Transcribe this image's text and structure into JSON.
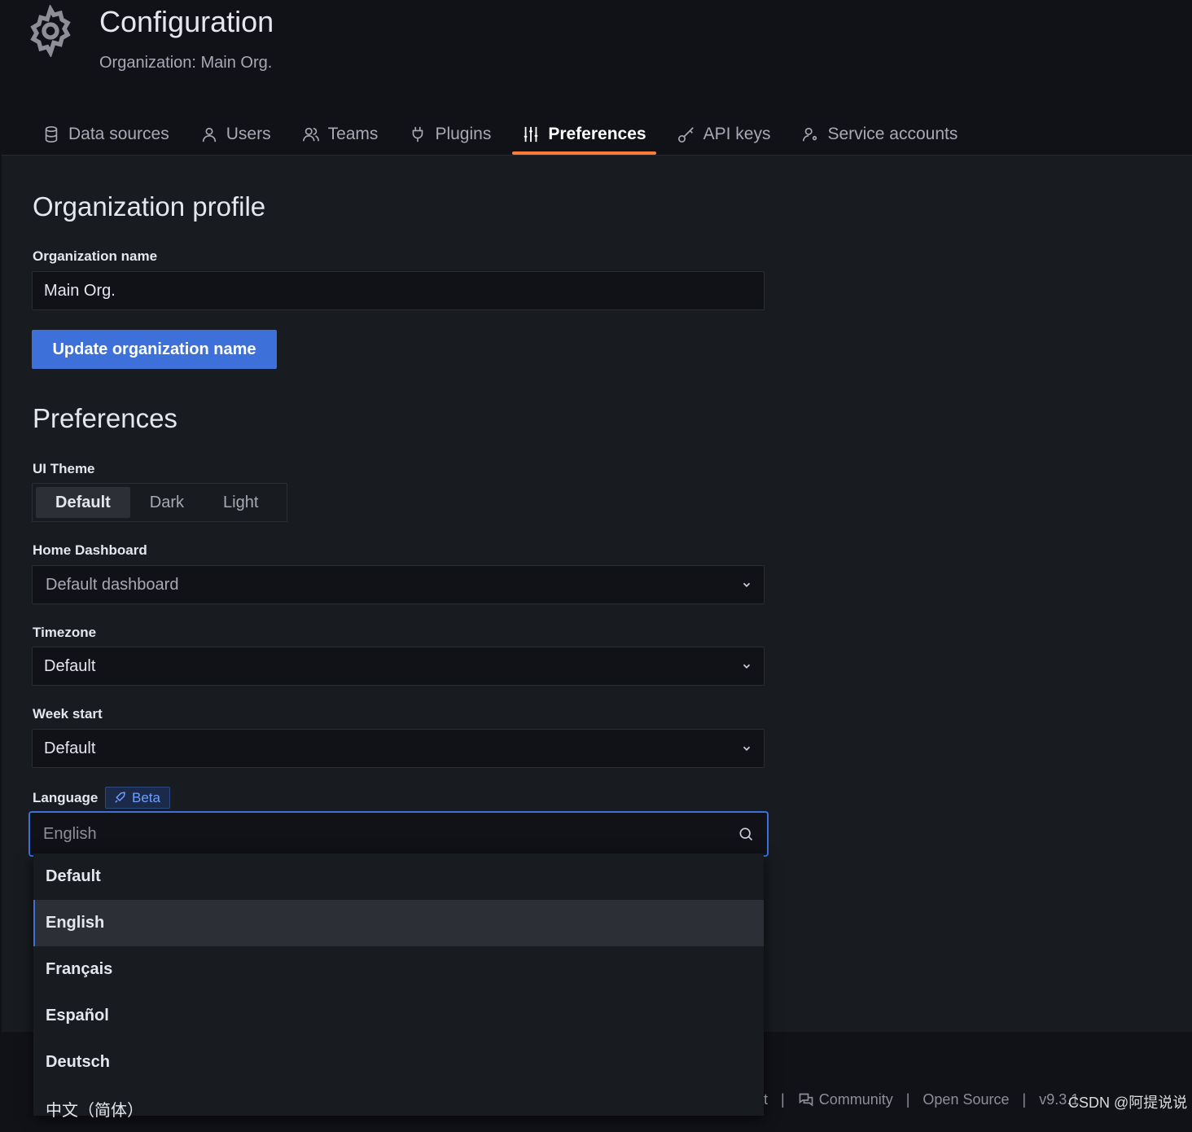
{
  "header": {
    "title": "Configuration",
    "subtitle": "Organization: Main Org.",
    "icon": "gear-icon"
  },
  "tabs": [
    {
      "label": "Data sources",
      "icon": "database-icon"
    },
    {
      "label": "Users",
      "icon": "user-icon"
    },
    {
      "label": "Teams",
      "icon": "users-icon"
    },
    {
      "label": "Plugins",
      "icon": "plug-icon"
    },
    {
      "label": "Preferences",
      "icon": "sliders-icon",
      "active": true
    },
    {
      "label": "API keys",
      "icon": "key-icon"
    },
    {
      "label": "Service accounts",
      "icon": "user-cog-icon"
    }
  ],
  "profile": {
    "heading": "Organization profile",
    "name_label": "Organization name",
    "name_value": "Main Org.",
    "update_button": "Update organization name"
  },
  "preferences": {
    "heading": "Preferences",
    "theme_label": "UI Theme",
    "theme_options": [
      "Default",
      "Dark",
      "Light"
    ],
    "theme_selected": "Default",
    "home_label": "Home Dashboard",
    "home_value": "Default dashboard",
    "timezone_label": "Timezone",
    "timezone_value": "Default",
    "week_label": "Week start",
    "week_value": "Default",
    "language_label": "Language",
    "beta_badge": "Beta",
    "language_placeholder": "English",
    "language_options": [
      "Default",
      "English",
      "Français",
      "Español",
      "Deutsch",
      "中文（简体）"
    ],
    "language_highlighted": "English"
  },
  "footer": {
    "partial": "t",
    "community": "Community",
    "open_source": "Open Source",
    "version": "v9.3.1"
  },
  "watermark": "CSDN @阿提说说",
  "colors": {
    "accent": "#3d71d9",
    "active_tab": "#ff7a3d"
  }
}
